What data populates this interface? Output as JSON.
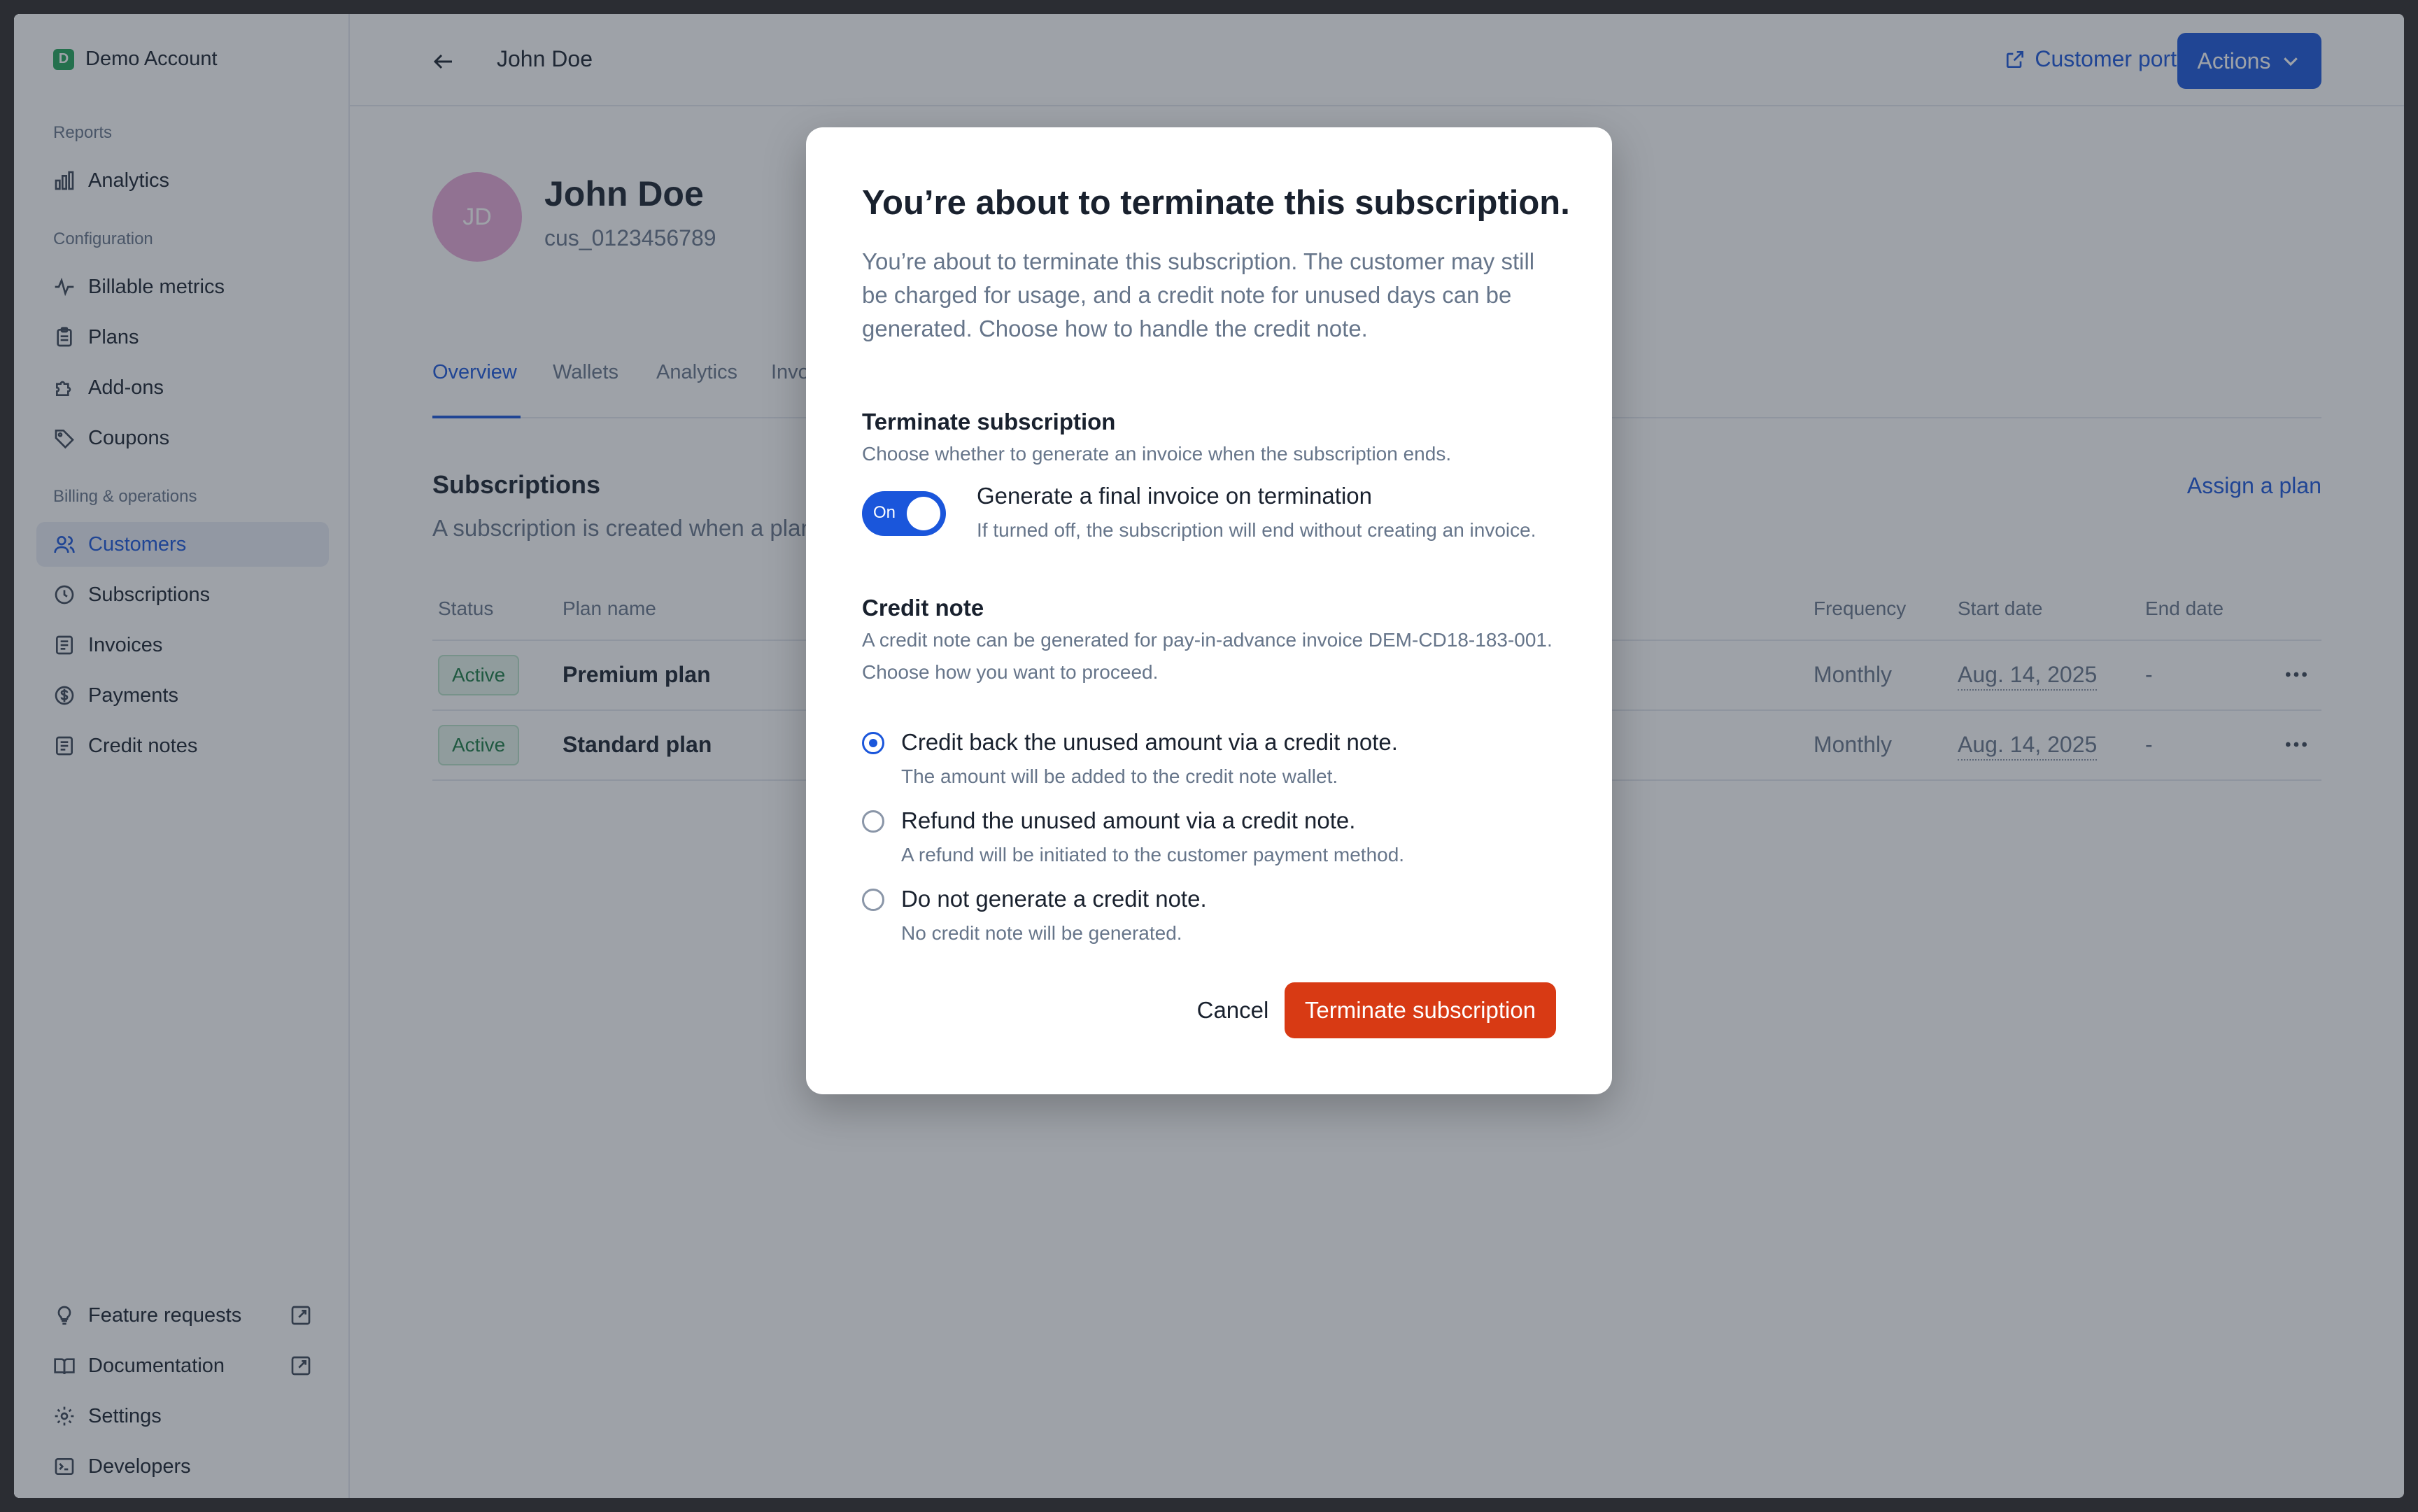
{
  "sidebar": {
    "org": {
      "badge": "D",
      "name": "Demo Account"
    },
    "sections": {
      "reports": "Reports",
      "configuration": "Configuration",
      "billing": "Billing & operations"
    },
    "items": {
      "analytics": "Analytics",
      "billable_metrics": "Billable metrics",
      "plans": "Plans",
      "addons": "Add-ons",
      "coupons": "Coupons",
      "customers": "Customers",
      "subscriptions": "Subscriptions",
      "invoices": "Invoices",
      "payments": "Payments",
      "credit_notes": "Credit notes",
      "feature_requests": "Feature requests",
      "documentation": "Documentation",
      "settings": "Settings",
      "developers": "Developers"
    },
    "active_item": "Customers"
  },
  "header": {
    "title": "John Doe",
    "portal_link": "Customer portal",
    "actions_label": "Actions"
  },
  "customer": {
    "initials": "JD",
    "name": "John Doe",
    "id": "cus_0123456789",
    "avatar_color": "#e7a8d8"
  },
  "tabs": [
    "Overview",
    "Wallets",
    "Analytics",
    "Invoices"
  ],
  "active_tab": "Overview",
  "subscriptions": {
    "title": "Subscriptions",
    "description": "A subscription is created when a plan",
    "assign_label": "Assign a plan",
    "columns": {
      "status": "Status",
      "plan": "Plan name",
      "frequency": "Frequency",
      "start": "Start date",
      "end": "End date"
    },
    "rows": [
      {
        "status": "Active",
        "plan": "Premium plan",
        "frequency": "Monthly",
        "start": "Aug. 14, 2025",
        "end": "-"
      },
      {
        "status": "Active",
        "plan": "Standard plan",
        "frequency": "Monthly",
        "start": "Aug. 14, 2025",
        "end": "-"
      }
    ]
  },
  "modal": {
    "title": "You’re about to terminate this subscription.",
    "description": "You’re about to terminate this subscription. The customer may still be charged for usage, and a credit note for unused days can be generated. Choose how to handle the credit note.",
    "terminate_section": {
      "title": "Terminate subscription",
      "subtitle": "Choose whether to generate an invoice when the subscription ends."
    },
    "toggle": {
      "state_label": "On",
      "on": true,
      "title": "Generate a final invoice on termination",
      "subtitle": "If turned off, the subscription will end without creating an invoice."
    },
    "credit_section": {
      "title": "Credit note",
      "subtitle": "A credit note can be generated for pay-in-advance invoice DEM-CD18-183-001. Choose how you want to proceed."
    },
    "options": [
      {
        "title": "Credit back the unused amount via a credit note.",
        "subtitle": "The amount will be added to the credit note wallet.",
        "checked": true
      },
      {
        "title": "Refund the unused amount via a credit note.",
        "subtitle": "A refund will be initiated to the customer payment method.",
        "checked": false
      },
      {
        "title": "Do not generate a credit note.",
        "subtitle": "No credit note will be generated.",
        "checked": false
      }
    ],
    "cancel_label": "Cancel",
    "confirm_label": "Terminate subscription"
  },
  "colors": {
    "accent": "#1a56db",
    "danger": "#d83a14",
    "success": "#1b7a44"
  }
}
